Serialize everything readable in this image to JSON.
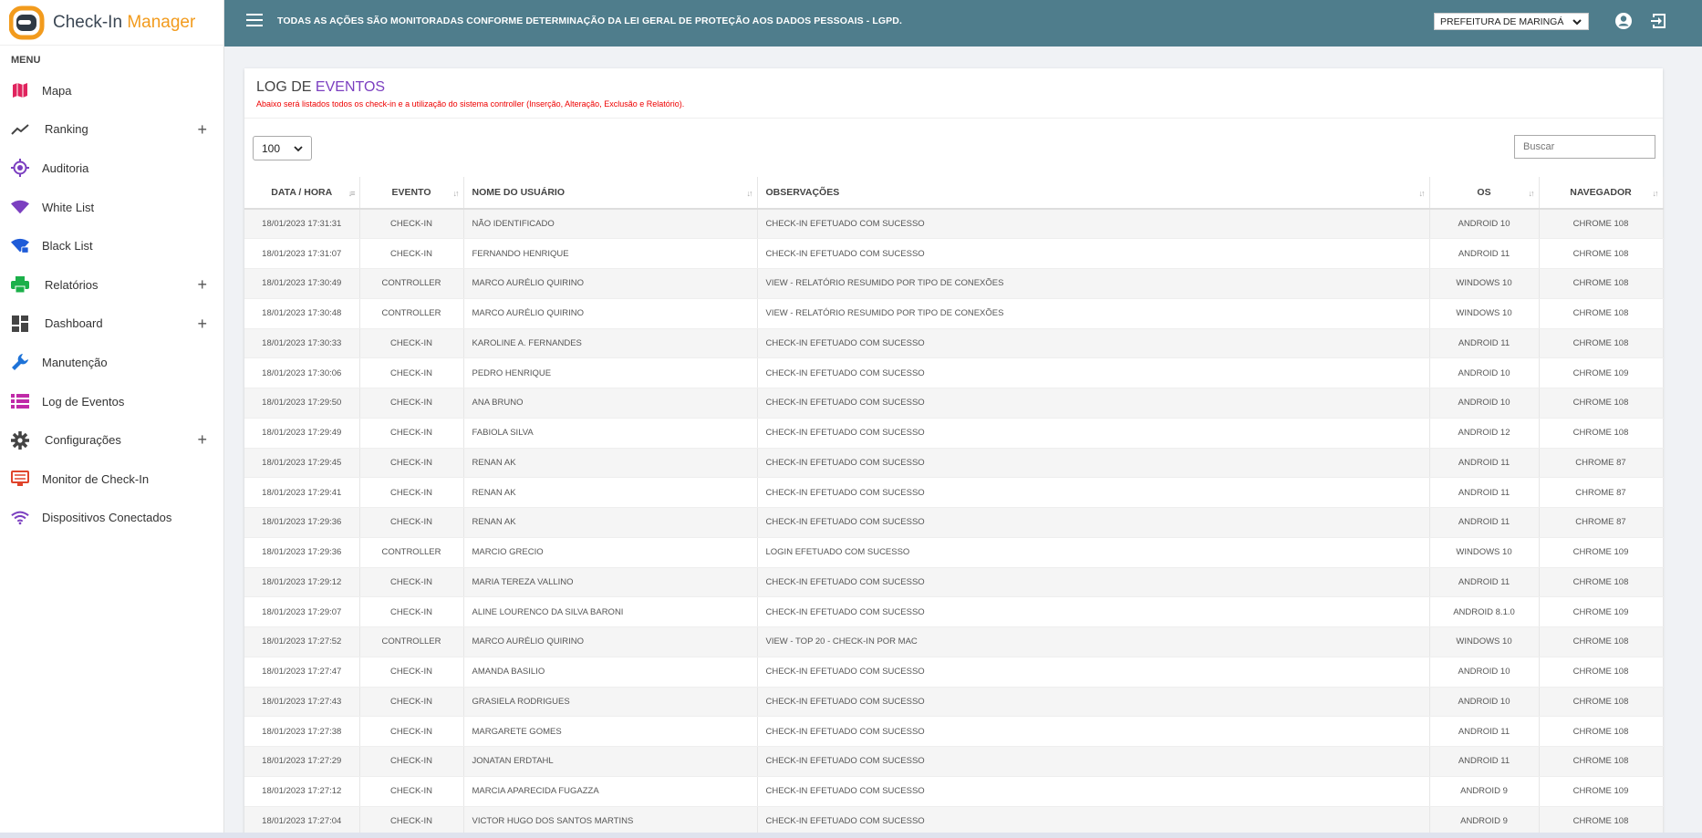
{
  "brand": {
    "name_part1": "Check-In",
    "name_part2": "Manager"
  },
  "sidebar": {
    "menu_title": "MENU",
    "items": [
      {
        "label": "Mapa",
        "icon": "map-icon",
        "color": "#e0245e",
        "expandable": false
      },
      {
        "label": "Ranking",
        "icon": "trending-icon",
        "color": "#444444",
        "expandable": true
      },
      {
        "label": "Auditoria",
        "icon": "crosshair-icon",
        "color": "#7b3fc0",
        "expandable": false
      },
      {
        "label": "White List",
        "icon": "wifi-icon",
        "color": "#7b3fc0",
        "expandable": false
      },
      {
        "label": "Black List",
        "icon": "wifi-lock-icon",
        "color": "#1e5bd8",
        "expandable": false
      },
      {
        "label": "Relatórios",
        "icon": "printer-icon",
        "color": "#1bb04a",
        "expandable": true
      },
      {
        "label": "Dashboard",
        "icon": "dashboard-icon",
        "color": "#444444",
        "expandable": true
      },
      {
        "label": "Manutenção",
        "icon": "wrench-icon",
        "color": "#1e73d8",
        "expandable": false
      },
      {
        "label": "Log de Eventos",
        "icon": "list-icon",
        "color": "#c02aa8",
        "expandable": false
      },
      {
        "label": "Configurações",
        "icon": "gear-icon",
        "color": "#444444",
        "expandable": true
      },
      {
        "label": "Monitor de Check-In",
        "icon": "monitor-list-icon",
        "color": "#e0442b",
        "expandable": false
      },
      {
        "label": "Dispositivos Conectados",
        "icon": "wifi-signal-icon",
        "color": "#7b3fc0",
        "expandable": false
      }
    ],
    "plus_symbol": "+"
  },
  "topbar": {
    "notice": "TODAS AS AÇÕES SÃO MONITORADAS CONFORME DETERMINAÇÃO DA LEI GERAL DE PROTEÇÃO AOS DADOS PESSOAIS - LGPD.",
    "city_selected": "PREFEITURA DE MARINGÁ",
    "bg_color": "#4f7d8c"
  },
  "page": {
    "title_part1": "LOG DE",
    "title_part2": "EVENTOS",
    "subtitle": "Abaixo será listados todos os check-in e a utilização do sistema controller (Inserção, Alteração, Exclusão e Relatório).",
    "page_length": "100",
    "search_placeholder": "Buscar"
  },
  "table": {
    "columns": [
      "DATA / HORA",
      "EVENTO",
      "NOME DO USUÁRIO",
      "OBSERVAÇÕES",
      "OS",
      "NAVEGADOR"
    ],
    "rows": [
      [
        "18/01/2023 17:31:31",
        "CHECK-IN",
        "NÃO IDENTIFICADO",
        "CHECK-IN EFETUADO COM SUCESSO",
        "ANDROID 10",
        "CHROME 108"
      ],
      [
        "18/01/2023 17:31:07",
        "CHECK-IN",
        "FERNANDO HENRIQUE",
        "CHECK-IN EFETUADO COM SUCESSO",
        "ANDROID 11",
        "CHROME 108"
      ],
      [
        "18/01/2023 17:30:49",
        "CONTROLLER",
        "MARCO AURÉLIO QUIRINO",
        "VIEW - RELATÓRIO RESUMIDO POR TIPO DE CONEXÕES",
        "WINDOWS 10",
        "CHROME 108"
      ],
      [
        "18/01/2023 17:30:48",
        "CONTROLLER",
        "MARCO AURÉLIO QUIRINO",
        "VIEW - RELATÓRIO RESUMIDO POR TIPO DE CONEXÕES",
        "WINDOWS 10",
        "CHROME 108"
      ],
      [
        "18/01/2023 17:30:33",
        "CHECK-IN",
        "KAROLINE A. FERNANDES",
        "CHECK-IN EFETUADO COM SUCESSO",
        "ANDROID 11",
        "CHROME 108"
      ],
      [
        "18/01/2023 17:30:06",
        "CHECK-IN",
        "PEDRO HENRIQUE",
        "CHECK-IN EFETUADO COM SUCESSO",
        "ANDROID 10",
        "CHROME 109"
      ],
      [
        "18/01/2023 17:29:50",
        "CHECK-IN",
        "ANA BRUNO",
        "CHECK-IN EFETUADO COM SUCESSO",
        "ANDROID 10",
        "CHROME 108"
      ],
      [
        "18/01/2023 17:29:49",
        "CHECK-IN",
        "FABIOLA SILVA",
        "CHECK-IN EFETUADO COM SUCESSO",
        "ANDROID 12",
        "CHROME 108"
      ],
      [
        "18/01/2023 17:29:45",
        "CHECK-IN",
        "RENAN AK",
        "CHECK-IN EFETUADO COM SUCESSO",
        "ANDROID 11",
        "CHROME 87"
      ],
      [
        "18/01/2023 17:29:41",
        "CHECK-IN",
        "RENAN AK",
        "CHECK-IN EFETUADO COM SUCESSO",
        "ANDROID 11",
        "CHROME 87"
      ],
      [
        "18/01/2023 17:29:36",
        "CHECK-IN",
        "RENAN AK",
        "CHECK-IN EFETUADO COM SUCESSO",
        "ANDROID 11",
        "CHROME 87"
      ],
      [
        "18/01/2023 17:29:36",
        "CONTROLLER",
        "MARCIO GRECIO",
        "LOGIN EFETUADO COM SUCESSO",
        "WINDOWS 10",
        "CHROME 109"
      ],
      [
        "18/01/2023 17:29:12",
        "CHECK-IN",
        "MARIA TEREZA VALLINO",
        "CHECK-IN EFETUADO COM SUCESSO",
        "ANDROID 11",
        "CHROME 108"
      ],
      [
        "18/01/2023 17:29:07",
        "CHECK-IN",
        "ALINE LOURENCO DA SILVA BARONI",
        "CHECK-IN EFETUADO COM SUCESSO",
        "ANDROID 8.1.0",
        "CHROME 109"
      ],
      [
        "18/01/2023 17:27:52",
        "CONTROLLER",
        "MARCO AURÉLIO QUIRINO",
        "VIEW - TOP 20 - CHECK-IN POR MAC",
        "WINDOWS 10",
        "CHROME 108"
      ],
      [
        "18/01/2023 17:27:47",
        "CHECK-IN",
        "AMANDA BASILIO",
        "CHECK-IN EFETUADO COM SUCESSO",
        "ANDROID 10",
        "CHROME 108"
      ],
      [
        "18/01/2023 17:27:43",
        "CHECK-IN",
        "GRASIELA RODRIGUES",
        "CHECK-IN EFETUADO COM SUCESSO",
        "ANDROID 10",
        "CHROME 108"
      ],
      [
        "18/01/2023 17:27:38",
        "CHECK-IN",
        "MARGARETE GOMES",
        "CHECK-IN EFETUADO COM SUCESSO",
        "ANDROID 11",
        "CHROME 108"
      ],
      [
        "18/01/2023 17:27:29",
        "CHECK-IN",
        "JONATAN ERDTAHL",
        "CHECK-IN EFETUADO COM SUCESSO",
        "ANDROID 11",
        "CHROME 108"
      ],
      [
        "18/01/2023 17:27:12",
        "CHECK-IN",
        "MARCIA APARECIDA FUGAZZA",
        "CHECK-IN EFETUADO COM SUCESSO",
        "ANDROID 9",
        "CHROME 109"
      ],
      [
        "18/01/2023 17:27:04",
        "CHECK-IN",
        "VICTOR HUGO DOS SANTOS MARTINS",
        "CHECK-IN EFETUADO COM SUCESSO",
        "ANDROID 9",
        "CHROME 108"
      ]
    ]
  }
}
